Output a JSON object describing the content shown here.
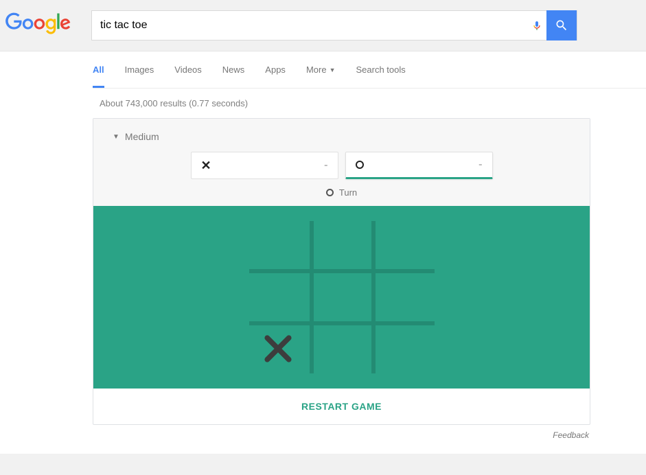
{
  "search": {
    "query": "tic tac toe"
  },
  "tabs": {
    "all": "All",
    "images": "Images",
    "videos": "Videos",
    "news": "News",
    "apps": "Apps",
    "more": "More",
    "tools": "Search tools"
  },
  "stats": "About 743,000 results (0.77 seconds)",
  "game": {
    "difficulty": "Medium",
    "player_x_score": "-",
    "player_o_score": "-",
    "turn_label": "Turn",
    "restart_label": "RESTART GAME",
    "board": [
      "",
      "",
      "",
      "",
      "",
      "",
      "X",
      "",
      ""
    ],
    "active_player": "O"
  },
  "feedback": "Feedback"
}
